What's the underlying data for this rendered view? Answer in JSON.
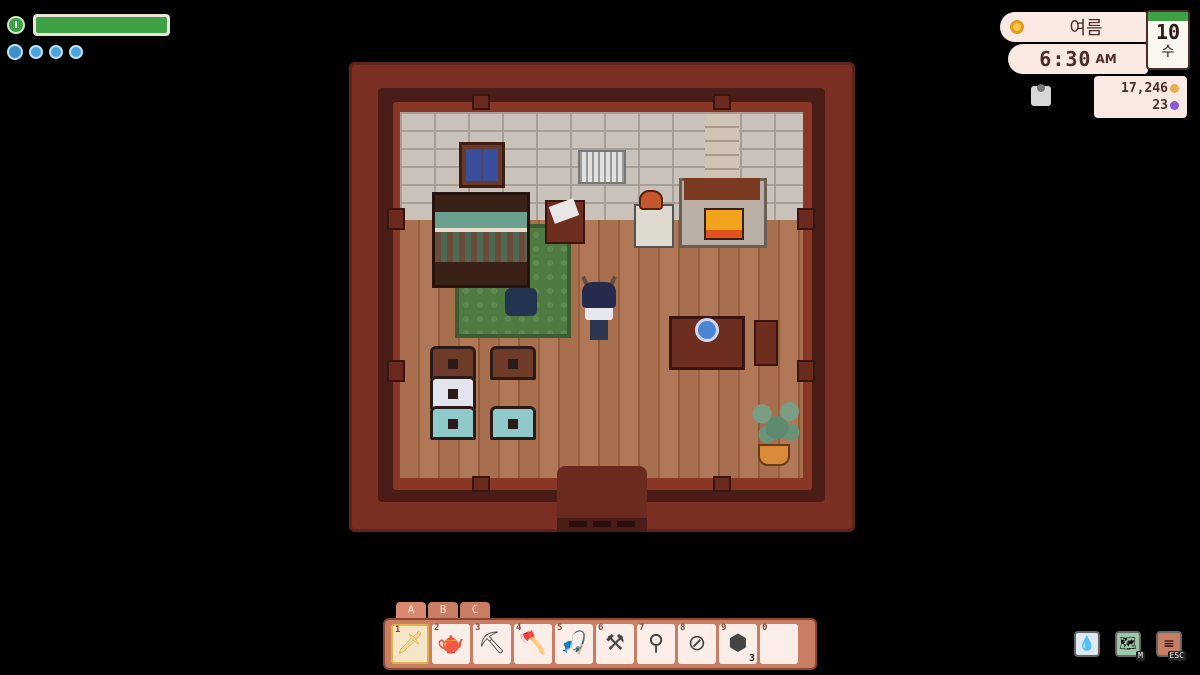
{
  "hud": {
    "energy_fraction": 1.0,
    "water_drops": 4,
    "season": "여름",
    "time": "6:30",
    "ampm": "AM",
    "calendar_day": "10",
    "calendar_weekday": "수",
    "gold": "17,246",
    "gems": "23",
    "colors": {
      "energy": "#3fa146",
      "panel": "#fbe9e4",
      "text": "#4a2c2a",
      "gold_coin": "#e2b34a",
      "gem": "#8a5ad0"
    }
  },
  "icons": {
    "energy": "energy-icon",
    "water": "water-drop-icon",
    "season": "sun-icon",
    "mail": "mail-icon",
    "gold": "gold-coin-icon",
    "gem": "gem-icon"
  },
  "hotbar": {
    "tabs": [
      "A",
      "B",
      "C"
    ],
    "selected_tab": "A",
    "selected_slot": 1,
    "slots": [
      {
        "num": "1",
        "item": "sword-icon",
        "glyph": "🗡",
        "qty": ""
      },
      {
        "num": "2",
        "item": "watering-can-icon",
        "glyph": "🫖",
        "qty": ""
      },
      {
        "num": "3",
        "item": "pickaxe-icon",
        "glyph": "⛏",
        "qty": ""
      },
      {
        "num": "4",
        "item": "axe-icon",
        "glyph": "🪓",
        "qty": ""
      },
      {
        "num": "5",
        "item": "fishing-rod-icon",
        "glyph": "🎣",
        "qty": ""
      },
      {
        "num": "6",
        "item": "hoe-icon",
        "glyph": "⚒",
        "qty": ""
      },
      {
        "num": "7",
        "item": "shovel-icon",
        "glyph": "⚲",
        "qty": ""
      },
      {
        "num": "8",
        "item": "bug-net-icon",
        "glyph": "⊘",
        "qty": ""
      },
      {
        "num": "9",
        "item": "stone-icon",
        "glyph": "⬢",
        "qty": "3"
      },
      {
        "num": "0",
        "item": "",
        "glyph": "",
        "qty": ""
      }
    ]
  },
  "buttons": {
    "water": {
      "name": "water-drop-icon",
      "glyph": "💧"
    },
    "map": {
      "name": "map-icon",
      "key": "M",
      "glyph": "🗺"
    },
    "menu": {
      "name": "menu-icon",
      "key": "ESC",
      "glyph": "≡"
    }
  },
  "scene": {
    "room": "house-interior",
    "objects": [
      "window",
      "wall-vent",
      "bed",
      "nightstand",
      "rug",
      "cat",
      "player",
      "chimney",
      "fireplace",
      "stove",
      "kettle",
      "table",
      "crystal-ball",
      "chair",
      "chest",
      "potted-plant",
      "door"
    ]
  }
}
